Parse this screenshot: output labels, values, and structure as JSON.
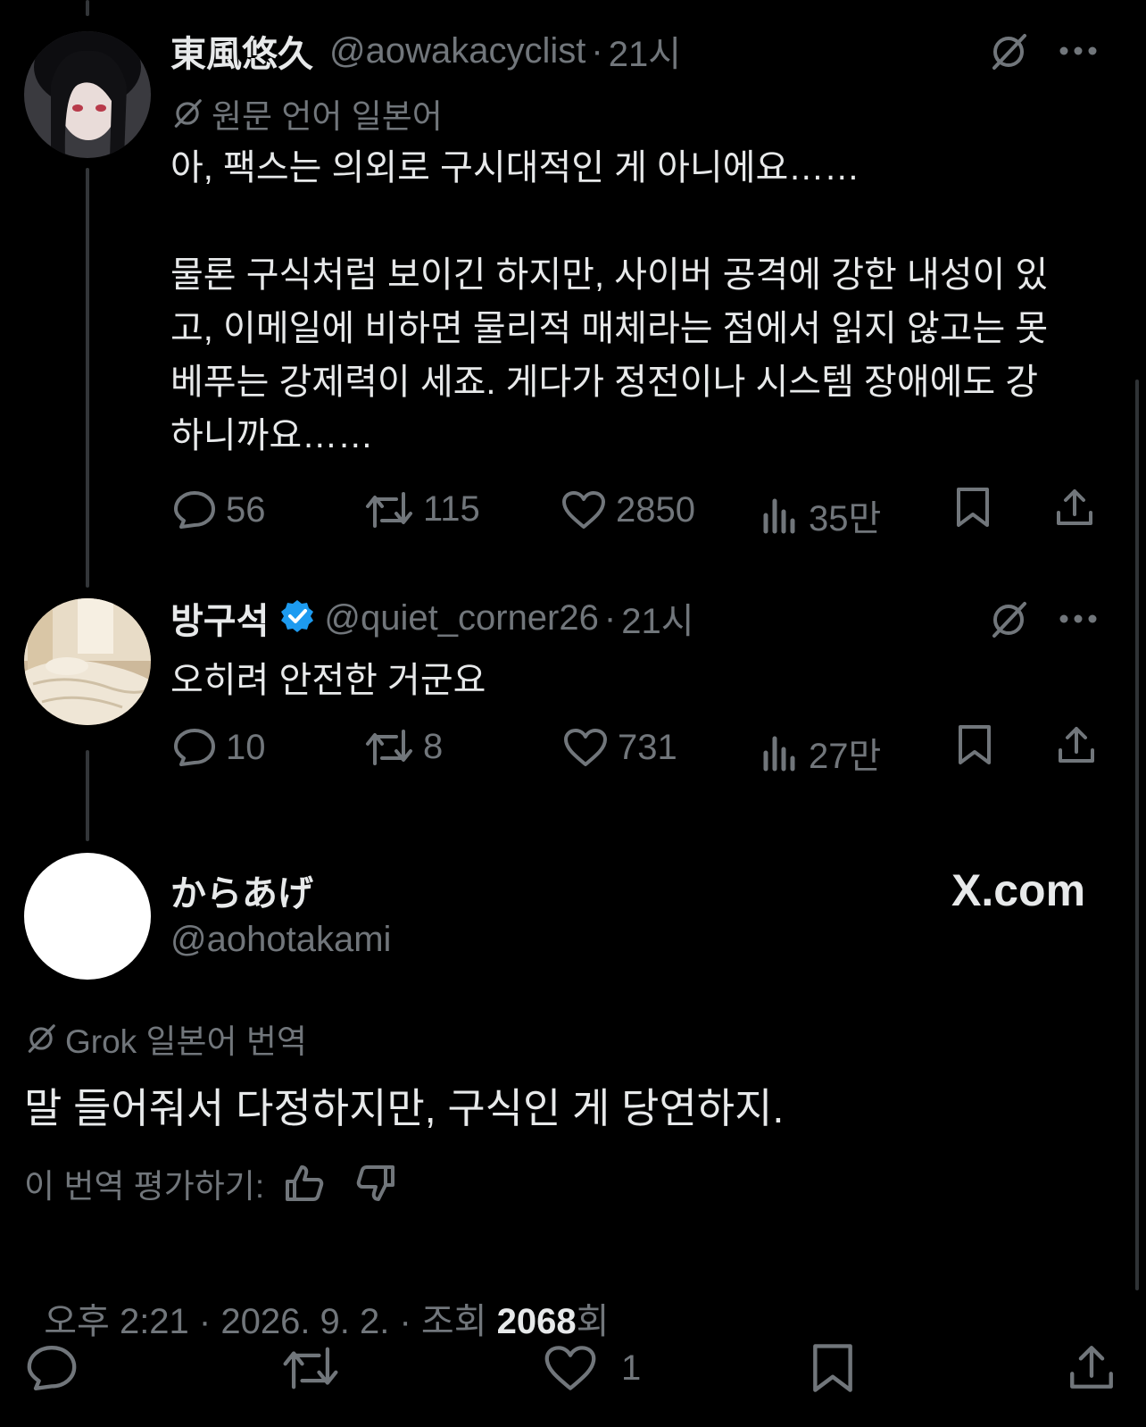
{
  "tweet1": {
    "name": "東風悠久",
    "handle": "@aowakacyclist",
    "time": "21시",
    "translate_note": "원문 언어 일본어",
    "text": "아, 팩스는 의외로 구시대적인 게 아니에요……\n\n물론 구식처럼 보이긴 하지만, 사이버 공격에 강한 내성이 있고, 이메일에 비하면 물리적 매체라는 점에서 읽지 않고는 못 베푸는 강제력이 세죠. 게다가 정전이나 시스템 장애에도 강하니까요……",
    "replies": "56",
    "reposts": "115",
    "likes": "2850",
    "views": "35만"
  },
  "tweet2": {
    "name": "방구석",
    "handle": "@quiet_corner26",
    "time": "21시",
    "text": "오히려 안전한 거군요",
    "replies": "10",
    "reposts": "8",
    "likes": "731",
    "views": "27만"
  },
  "main": {
    "name": "からあげ",
    "handle": "@aohotakami",
    "site": "X.com",
    "translate_note": "Grok 일본어 번역",
    "text": "말 들어줘서 다정하지만, 구식인 게 당연하지.",
    "rate_label": "이 번역 평가하기:",
    "meta_time": "오후 2:21 · 2026. 9. 2. · 조회 ",
    "meta_views": "2068",
    "meta_views_suffix": "회",
    "likes": "1"
  },
  "colors": {
    "background": "#000000",
    "text": "#e7e9ea",
    "secondary": "#71767b",
    "verified": "#1d9bf0"
  },
  "icons": [
    "reply-icon",
    "repost-icon",
    "like-icon",
    "views-icon",
    "bookmark-icon",
    "share-icon",
    "grok-icon",
    "more-icon",
    "verified-badge-icon",
    "thumbs-up-icon",
    "thumbs-down-icon"
  ]
}
